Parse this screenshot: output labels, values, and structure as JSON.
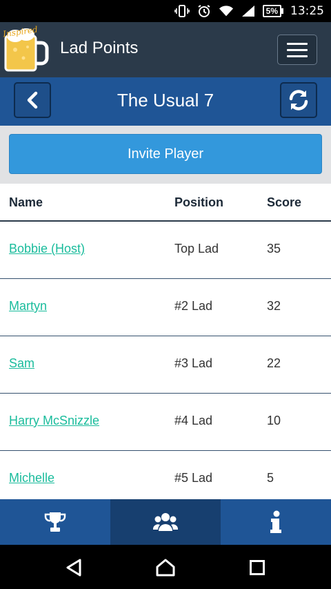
{
  "status_bar": {
    "time": "13:25",
    "battery_percent": "5%",
    "icons": [
      "vibrate-icon",
      "alarm-icon",
      "wifi-icon",
      "signal-icon",
      "battery-icon"
    ]
  },
  "app_bar": {
    "title": "Lad Points",
    "logo_text": "Inspired"
  },
  "group": {
    "title": "The Usual 7"
  },
  "invite": {
    "label": "Invite Player"
  },
  "table": {
    "headers": {
      "name": "Name",
      "position": "Position",
      "score": "Score"
    },
    "rows": [
      {
        "name": "Bobbie (Host)",
        "position": "Top Lad",
        "score": "35"
      },
      {
        "name": "Martyn",
        "position": "#2 Lad",
        "score": "32"
      },
      {
        "name": "Sam",
        "position": "#3 Lad",
        "score": "22"
      },
      {
        "name": "Harry McSnizzle",
        "position": "#4 Lad",
        "score": "10"
      },
      {
        "name": "Michelle",
        "position": "#5 Lad",
        "score": "5"
      }
    ]
  },
  "tabs": [
    {
      "icon": "trophy-icon",
      "active": false
    },
    {
      "icon": "group-icon",
      "active": true
    },
    {
      "icon": "info-icon",
      "active": false
    }
  ],
  "colors": {
    "app_bar": "#2b3a4a",
    "header_blue": "#1f5596",
    "invite_blue": "#3398dc",
    "link_teal": "#1abc9c"
  }
}
